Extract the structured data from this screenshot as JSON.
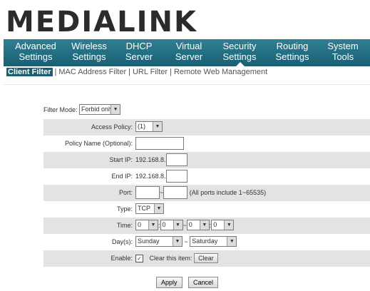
{
  "brand": {
    "logo_text": "MEDIALINK"
  },
  "nav": [
    {
      "line1": "Advanced",
      "line2": "Settings"
    },
    {
      "line1": "Wireless",
      "line2": "Settings"
    },
    {
      "line1": "DHCP",
      "line2": "Server"
    },
    {
      "line1": "Virtual",
      "line2": "Server"
    },
    {
      "line1": "Security",
      "line2": "Settings"
    },
    {
      "line1": "Routing",
      "line2": "Settings"
    },
    {
      "line1": "System",
      "line2": "Tools"
    }
  ],
  "subnav": {
    "active": "Client Filter",
    "items": [
      "MAC Address Filter",
      "URL Filter",
      "Remote Web Management"
    ]
  },
  "form": {
    "filter_mode_label": "Filter Mode:",
    "filter_mode_value": "Forbid only",
    "access_policy_label": "Access Policy:",
    "access_policy_value": "(1)",
    "policy_name_label": "Policy Name (Optional):",
    "start_ip_label": "Start IP:",
    "start_ip_prefix": "192.168.8.",
    "end_ip_label": "End IP:",
    "end_ip_prefix": "192.168.8.",
    "port_label": "Port:",
    "port_sep": "~",
    "port_hint": "(All ports include 1~65535)",
    "type_label": "Type:",
    "type_value": "TCP",
    "time_label": "Time:",
    "time_values": [
      "0",
      "0",
      "0",
      "0"
    ],
    "time_colon": ":",
    "time_sep": "~",
    "days_label": "Day(s):",
    "day_from": "Sunday",
    "day_sep": "~",
    "day_to": "Saturday",
    "enable_label": "Enable:",
    "enable_checked": "✓",
    "clear_item_label": "Clear this item:",
    "clear_button": "Clear",
    "apply_button": "Apply",
    "cancel_button": "Cancel"
  },
  "colors": {
    "nav_bg": "#1a5f74",
    "row_shade": "#e3e3e3"
  },
  "icons": {
    "dropdown": "dropdown-arrow-icon",
    "checkbox": "checkmark-icon"
  }
}
